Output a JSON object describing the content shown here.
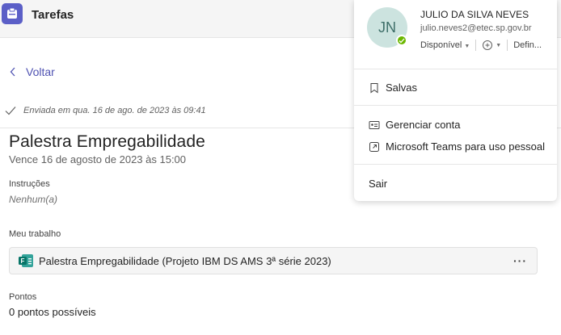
{
  "header": {
    "app_title": "Tarefas",
    "app_icon": "assignments-icon",
    "brand_color": "#5b5fc7"
  },
  "nav": {
    "back_label": "Voltar",
    "back_icon": "chevron-left-icon"
  },
  "assignment": {
    "sent_text": "Enviada em qua. 16 de ago. de 2023 às 09:41",
    "title": "Palestra Empregabilidade",
    "due": "Vence 16 de agosto de 2023 às 15:00",
    "instructions_label": "Instruções",
    "instructions_value": "Nenhum(a)",
    "my_work_label": "Meu trabalho",
    "work_item": {
      "label": "Palestra Empregabilidade (Projeto IBM DS AMS 3ª série 2023)",
      "icon": "forms-icon",
      "more": "···"
    },
    "points_label": "Pontos",
    "points_value": "0 pontos possíveis"
  },
  "profile_panel": {
    "initials": "JN",
    "name": "JULIO DA SILVA NEVES",
    "email": "julio.neves2@etec.sp.gov.br",
    "presence_color": "#6bb700",
    "status": "Disponível",
    "settings_short": "Defin...",
    "menu": {
      "saved": "Salvas",
      "manage_account": "Gerenciar conta",
      "teams_personal": "Microsoft Teams para uso pessoal",
      "sign_out": "Sair"
    }
  }
}
